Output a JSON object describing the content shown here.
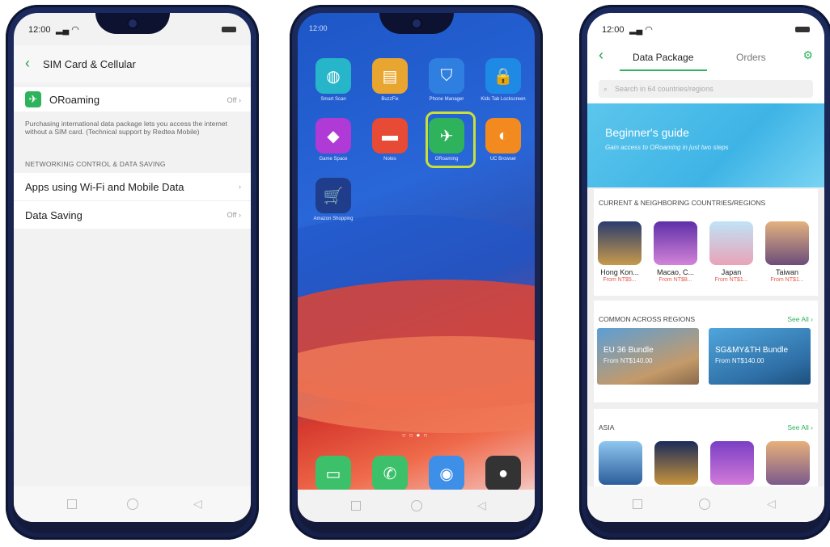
{
  "colors": {
    "accent_green": "#2eb35c",
    "price_red": "#e8564c",
    "banner_blue": "#3eb4e6"
  },
  "phone1": {
    "status_time": "12:00",
    "header_title": "SIM Card & Cellular",
    "oroaming_label": "ORoaming",
    "oroaming_value": "Off",
    "oroaming_description": "Purchasing international data package lets you access the internet without a SIM card. (Technical support by Redtea Mobile)",
    "section_heading": "NETWORKING CONTROL & DATA SAVING",
    "apps_row_label": "Apps using Wi-Fi and Mobile Data",
    "data_saving_label": "Data Saving",
    "data_saving_value": "Off"
  },
  "phone2": {
    "status_text": "12:00",
    "icons": [
      {
        "label": "Smart Scan",
        "color": "#26b5c9",
        "icon": "scan-icon"
      },
      {
        "label": "BuzzFix",
        "color": "#e8a630",
        "icon": "book-icon"
      },
      {
        "label": "Phone Manager",
        "color": "#2f7fe0",
        "icon": "shield-icon"
      },
      {
        "label": "Kids Tab Lockscreen",
        "color": "#1e8ae6",
        "icon": "lock-icon"
      },
      {
        "label": "Game Space",
        "color": "#b03ad6",
        "icon": "game-icon"
      },
      {
        "label": "Notes",
        "color": "#e74a35",
        "icon": "note-icon"
      },
      {
        "label": "ORoaming",
        "color": "#2eb35c",
        "icon": "plane-icon"
      },
      {
        "label": "UC Browser",
        "color": "#f28a1f",
        "icon": "browser-icon"
      },
      {
        "label": "Amazon Shopping",
        "color": "#1f3d8a",
        "icon": "cart-icon"
      }
    ],
    "dock": [
      {
        "name": "messages-icon",
        "color": "#3cc06a",
        "glyph": "▭"
      },
      {
        "name": "phone-icon",
        "color": "#3cc06a",
        "glyph": "✆"
      },
      {
        "name": "browser-icon",
        "color": "#3d8fe8",
        "glyph": "◉"
      },
      {
        "name": "camera-icon",
        "color": "#333333",
        "glyph": "●"
      }
    ]
  },
  "phone3": {
    "status_time": "12:00",
    "tab_data_package": "Data Package",
    "tab_orders": "Orders",
    "search_placeholder": "Search in 64 countries/regions",
    "banner_title": "Beginner's guide",
    "banner_subtitle": "Gain access to ORoaming in just two steps",
    "section1_title": "CURRENT & NEIGHBORING COUNTRIES/REGIONS",
    "section1_items": [
      {
        "name": "Hong Kon...",
        "price": "From NT$5..."
      },
      {
        "name": "Macao, C...",
        "price": "From NT$8..."
      },
      {
        "name": "Japan",
        "price": "From NT$1..."
      },
      {
        "name": "Taiwan",
        "price": "From NT$1..."
      }
    ],
    "section2_title": "COMMON ACROSS REGIONS",
    "section2_see_all": "See All ›",
    "bundles": [
      {
        "title": "EU 36 Bundle",
        "price": "From NT$140.00"
      },
      {
        "title": "SG&MY&TH Bundle",
        "price": "From NT$140.00"
      }
    ],
    "section3_title": "ASIA",
    "section3_see_all": "See All ›"
  }
}
